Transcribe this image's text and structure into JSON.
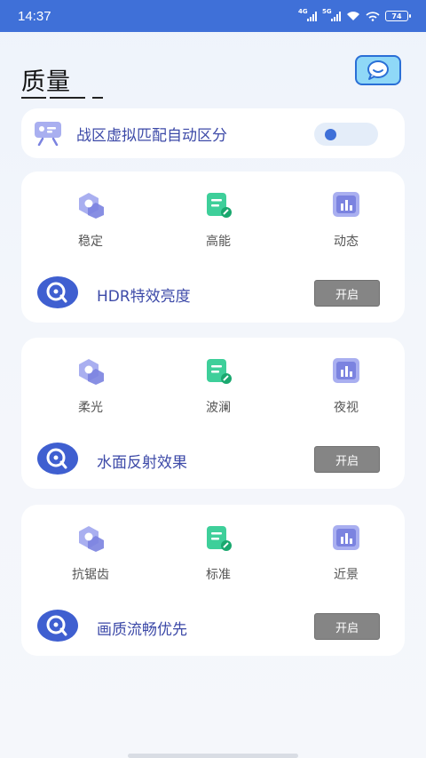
{
  "status": {
    "time": "14:37",
    "net1": "4G",
    "net2": "5G",
    "battery": "74"
  },
  "header": {
    "title": "质量"
  },
  "toggle_card": {
    "label": "战区虚拟匹配自动区分",
    "enabled": true
  },
  "groups": [
    {
      "options": [
        "稳定",
        "高能",
        "动态"
      ],
      "feature": {
        "label": "HDR特效亮度",
        "button": "开启"
      }
    },
    {
      "options": [
        "柔光",
        "波澜",
        "夜视"
      ],
      "feature": {
        "label": "水面反射效果",
        "button": "开启"
      }
    },
    {
      "options": [
        "抗锯齿",
        "标准",
        "近景"
      ],
      "feature": {
        "label": "画质流畅优先",
        "button": "开启"
      }
    }
  ],
  "colors": {
    "statusbar": "#3f70d8",
    "accent_text": "#3d4aa8",
    "button": "#858585",
    "icon_green": "#3ecf9a",
    "icon_purple": "#8e96e6"
  }
}
